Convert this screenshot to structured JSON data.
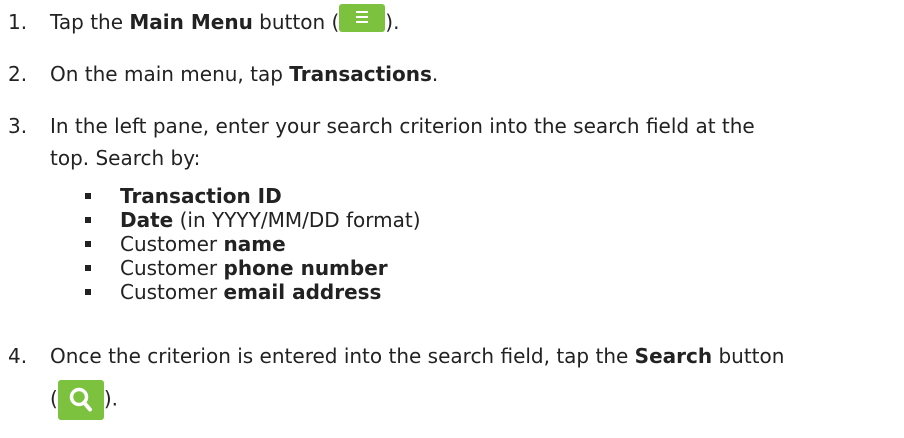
{
  "steps": [
    {
      "number": "1.",
      "before": "Tap the ",
      "bold": "Main Menu",
      "middle": " button (",
      "icon": "menu-icon",
      "after": ")."
    },
    {
      "number": "2.",
      "before": "On the main menu, tap ",
      "bold": "Transactions",
      "after": "."
    },
    {
      "number": "3.",
      "line1": "In the left pane, enter your search criterion into the search field at the",
      "line2": "top. Search by:"
    },
    {
      "number": "4.",
      "line1_before": "Once the criterion is entered into the search field, tap the ",
      "line1_bold": "Search",
      "line1_after": " button",
      "line2_open": "(",
      "icon": "search-icon",
      "line2_close": ")."
    }
  ],
  "search_by": [
    {
      "prefix": "",
      "bold": "Transaction ID",
      "suffix": ""
    },
    {
      "prefix": "",
      "bold": "Date",
      "suffix": " (in YYYY/MM/DD format)"
    },
    {
      "prefix": "Customer ",
      "bold": "name",
      "suffix": ""
    },
    {
      "prefix": "Customer ",
      "bold": "phone number",
      "suffix": ""
    },
    {
      "prefix": "Customer ",
      "bold": "email address",
      "suffix": ""
    }
  ],
  "colors": {
    "button_green": "#7cc23f",
    "text": "#222222"
  }
}
